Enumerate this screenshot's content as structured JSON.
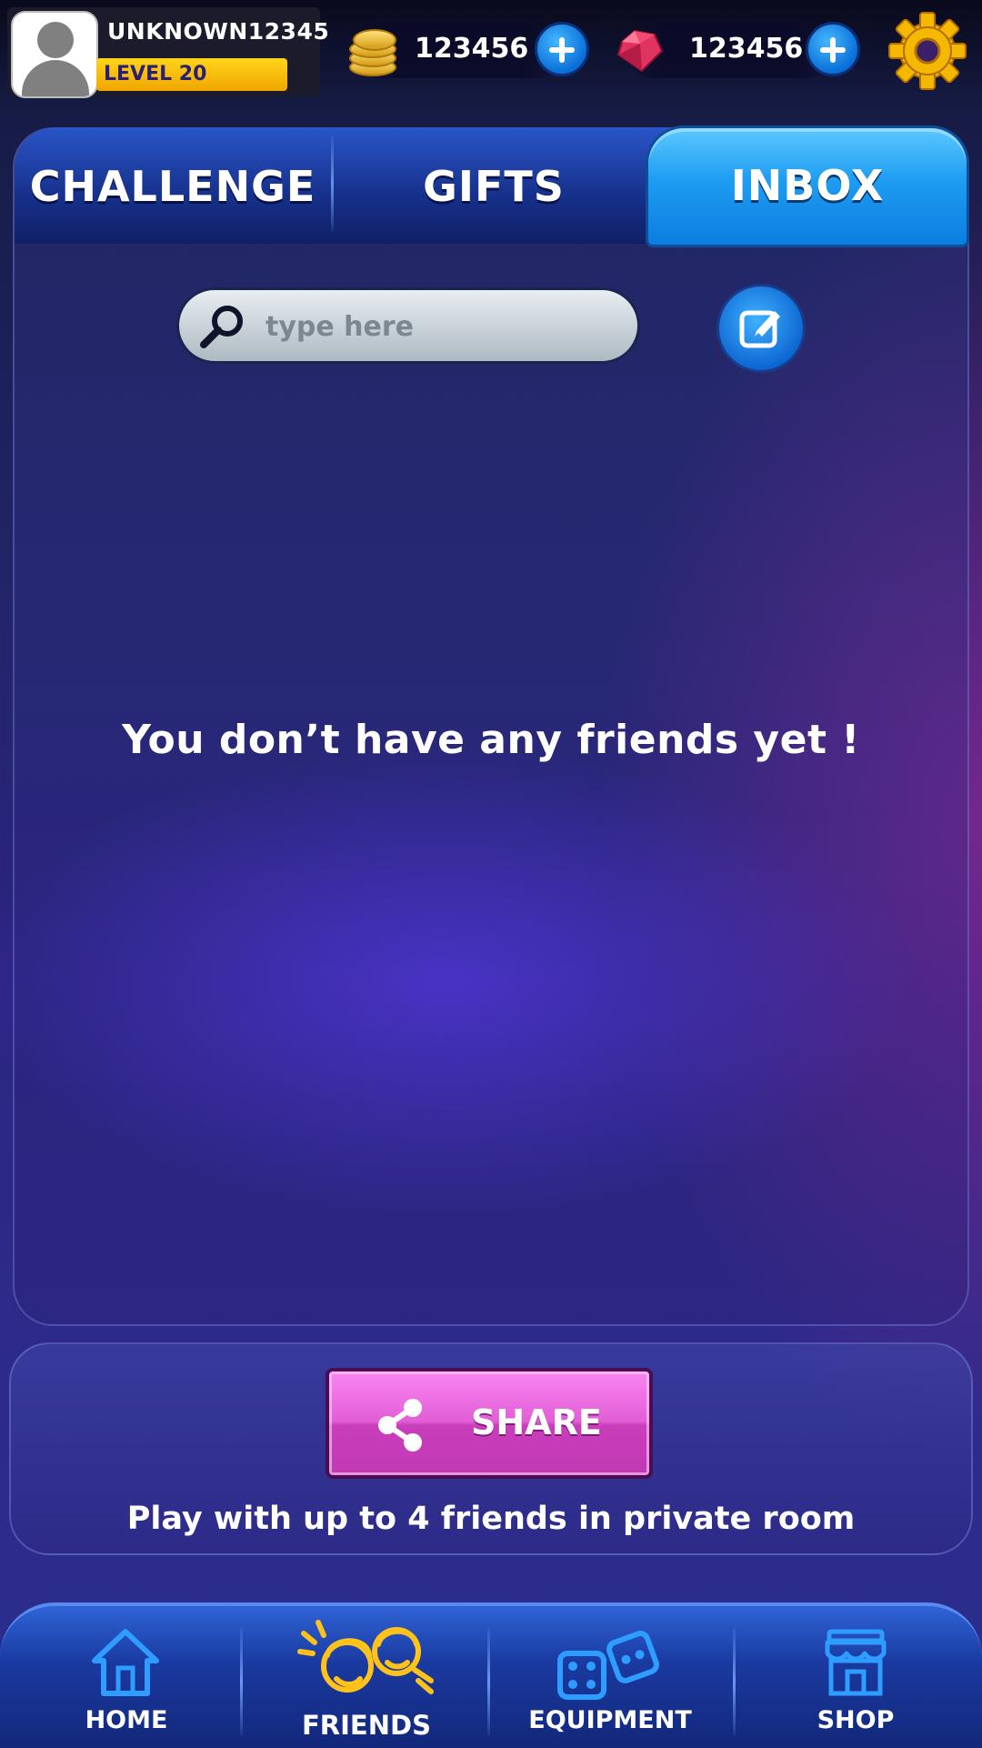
{
  "profile": {
    "username": "UNKNOWN12345",
    "level": "LEVEL 20",
    "avatar_icon": "user-silhouette-icon"
  },
  "currencies": {
    "coins": {
      "value": "123456",
      "icon": "coin-stack-icon"
    },
    "gems": {
      "value": "123456",
      "icon": "gem-icon"
    }
  },
  "settings_icon": "gear-icon",
  "tabs": [
    {
      "label": "CHALLENGE",
      "active": false
    },
    {
      "label": "GIFTS",
      "active": false
    },
    {
      "label": "INBOX",
      "active": true
    }
  ],
  "search": {
    "placeholder": "type here",
    "value": ""
  },
  "empty_message": "You don’t have any friends yet !",
  "share": {
    "label": "SHARE",
    "caption": "Play with up to 4 friends in private room"
  },
  "bottom_nav": [
    {
      "label": "HOME",
      "icon": "house-icon"
    },
    {
      "label": "FRIENDS",
      "icon": "friends-icon",
      "active": true
    },
    {
      "label": "EQUIPMENT",
      "icon": "dice-icon"
    },
    {
      "label": "SHOP",
      "icon": "store-icon"
    }
  ],
  "colors": {
    "accent_blue": "#1e9cf2",
    "level_yellow": "#ffc21a",
    "share_pink": "#e25fd6",
    "active_nav": "#ffd21a"
  }
}
